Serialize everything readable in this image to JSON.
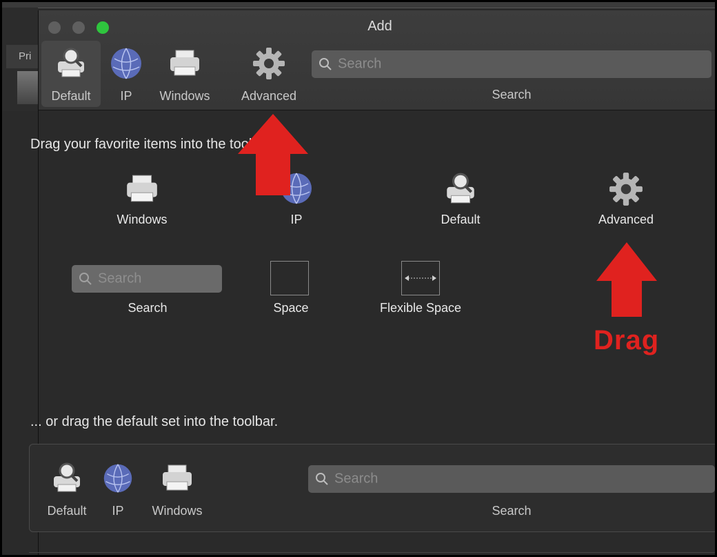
{
  "window": {
    "title": "Add",
    "background_tab_label": "Pri"
  },
  "toolbar": {
    "items": [
      {
        "label": "Default",
        "icon": "printer-magnifier-icon",
        "selected": true
      },
      {
        "label": "IP",
        "icon": "globe-icon",
        "selected": false
      },
      {
        "label": "Windows",
        "icon": "printer-icon",
        "selected": false
      },
      {
        "label": "Advanced",
        "icon": "gear-icon",
        "selected": false
      }
    ],
    "search": {
      "placeholder": "Search",
      "label": "Search"
    }
  },
  "palette": {
    "heading": "Drag your favorite items into the toolbar...",
    "items": [
      {
        "label": "Windows",
        "icon": "printer-icon"
      },
      {
        "label": "IP",
        "icon": "globe-icon"
      },
      {
        "label": "Default",
        "icon": "printer-magnifier-icon"
      },
      {
        "label": "Advanced",
        "icon": "gear-icon"
      },
      {
        "label": "Search",
        "placeholder": "Search",
        "icon": "search-field"
      },
      {
        "label": "Space",
        "icon": "space-box"
      },
      {
        "label": "Flexible Space",
        "icon": "flexible-space-box"
      }
    ]
  },
  "default_set": {
    "heading": "... or drag the default set into the toolbar.",
    "items": [
      {
        "label": "Default",
        "icon": "printer-magnifier-icon"
      },
      {
        "label": "IP",
        "icon": "globe-icon"
      },
      {
        "label": "Windows",
        "icon": "printer-icon"
      }
    ],
    "search": {
      "placeholder": "Search",
      "label": "Search"
    }
  },
  "annotation": {
    "drag_text": "Drag",
    "color": "#e0221f"
  },
  "colors": {
    "close": "#5f5f5f",
    "minimize": "#5f5f5f",
    "zoom": "#2fc53e"
  }
}
